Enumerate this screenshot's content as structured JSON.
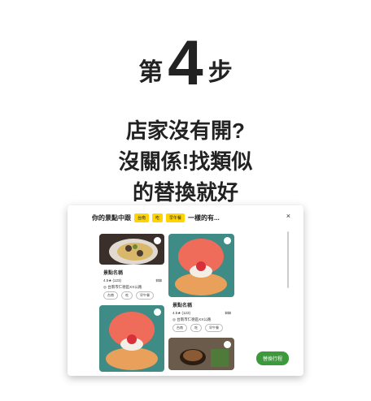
{
  "step": {
    "prefix": "第",
    "number": "4",
    "suffix": "步"
  },
  "headline": [
    "店家沒有開?",
    "沒關係!找類似",
    "的替換就好"
  ],
  "card": {
    "title_before": "你的景點中跟",
    "tags": [
      "台南",
      "吃",
      "早午餐"
    ],
    "title_after": "一樣的有...",
    "close_label": "×",
    "places": [
      {
        "name": "景點名稱",
        "rating": "4.5★ (123)",
        "price": "$$$",
        "address": "台南市仁德區XX公路",
        "chips": [
          "台南",
          "吃",
          "早午餐"
        ]
      },
      {
        "name": "景點名稱",
        "rating": "4.5★ (123)",
        "price": "$$$",
        "address": "台南市仁德區XX公路",
        "chips": [
          "台南",
          "吃",
          "早午餐"
        ]
      }
    ],
    "cta_label": "替換行程"
  },
  "colors": {
    "tag": "#ffd400",
    "cta": "#3c9a3c"
  }
}
